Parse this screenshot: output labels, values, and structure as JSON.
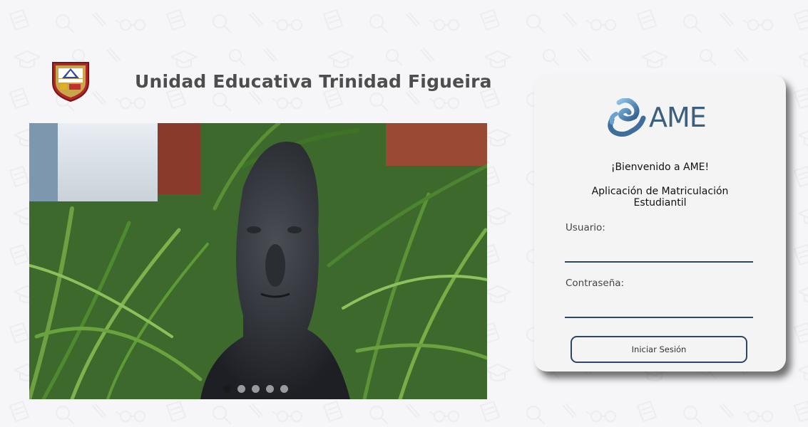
{
  "header": {
    "school_name": "Unidad Educativa Trinidad Figueira"
  },
  "carousel": {
    "slide_count": 5,
    "active_index": 0,
    "slide_description_icon": "bust-statue-photo"
  },
  "login": {
    "brand": "AME",
    "welcome": "¡Bienvenido a AME!",
    "subtitle": "Aplicación de Matriculación Estudiantil",
    "username_label": "Usuario:",
    "username_value": "",
    "password_label": "Contraseña:",
    "password_value": "",
    "submit_label": "Iniciar Sesión"
  },
  "colors": {
    "page_bg": "#f6f6f8",
    "card_bg": "#f4f4f4",
    "title_text": "#4d4d4d",
    "input_border": "#2e4565",
    "brand_blue": "#3a5f7f"
  }
}
